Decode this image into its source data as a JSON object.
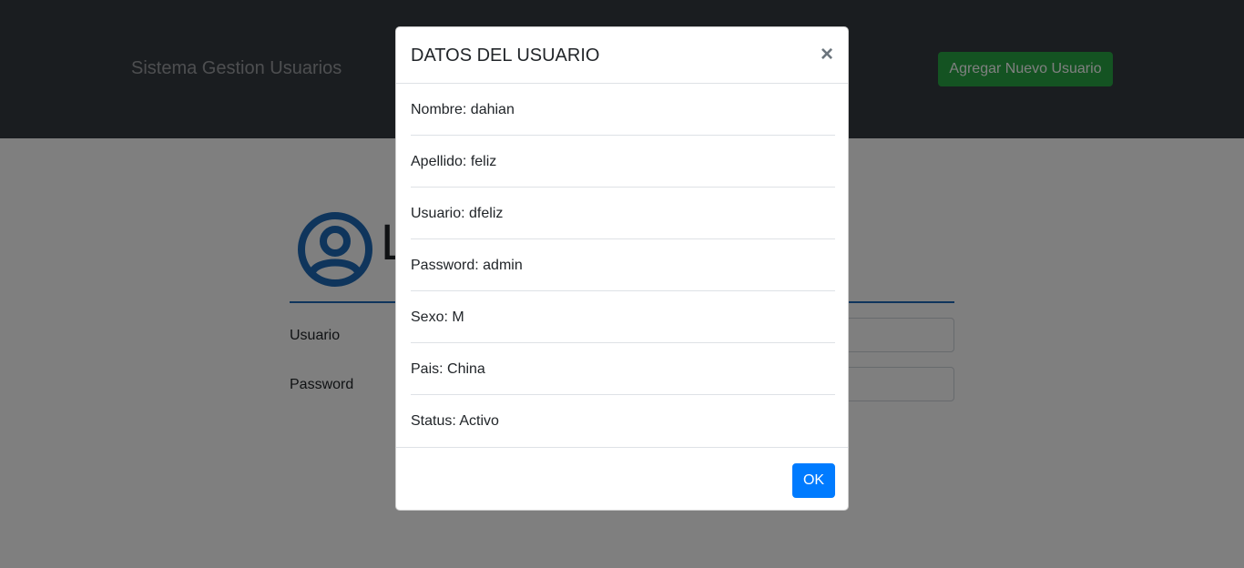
{
  "navbar": {
    "brand": "Sistema Gestion Usuarios",
    "add_button_label": "Agregar Nuevo Usuario"
  },
  "login": {
    "title": "L",
    "usuario_label": "Usuario",
    "password_label": "Password",
    "icon": "user-circle-icon"
  },
  "modal": {
    "title": "DATOS DEL USUARIO",
    "close_symbol": "×",
    "fields": [
      "Nombre: dahian",
      "Apellido: feliz",
      "Usuario: dfeliz",
      "Password: admin",
      "Sexo: M",
      "Pais: China",
      "Status: Activo"
    ],
    "ok_label": "OK"
  },
  "colors": {
    "navbar_bg": "#343a40",
    "add_button": "#28a745",
    "ok_button": "#007bff",
    "icon_blue": "#1f6bb8"
  }
}
